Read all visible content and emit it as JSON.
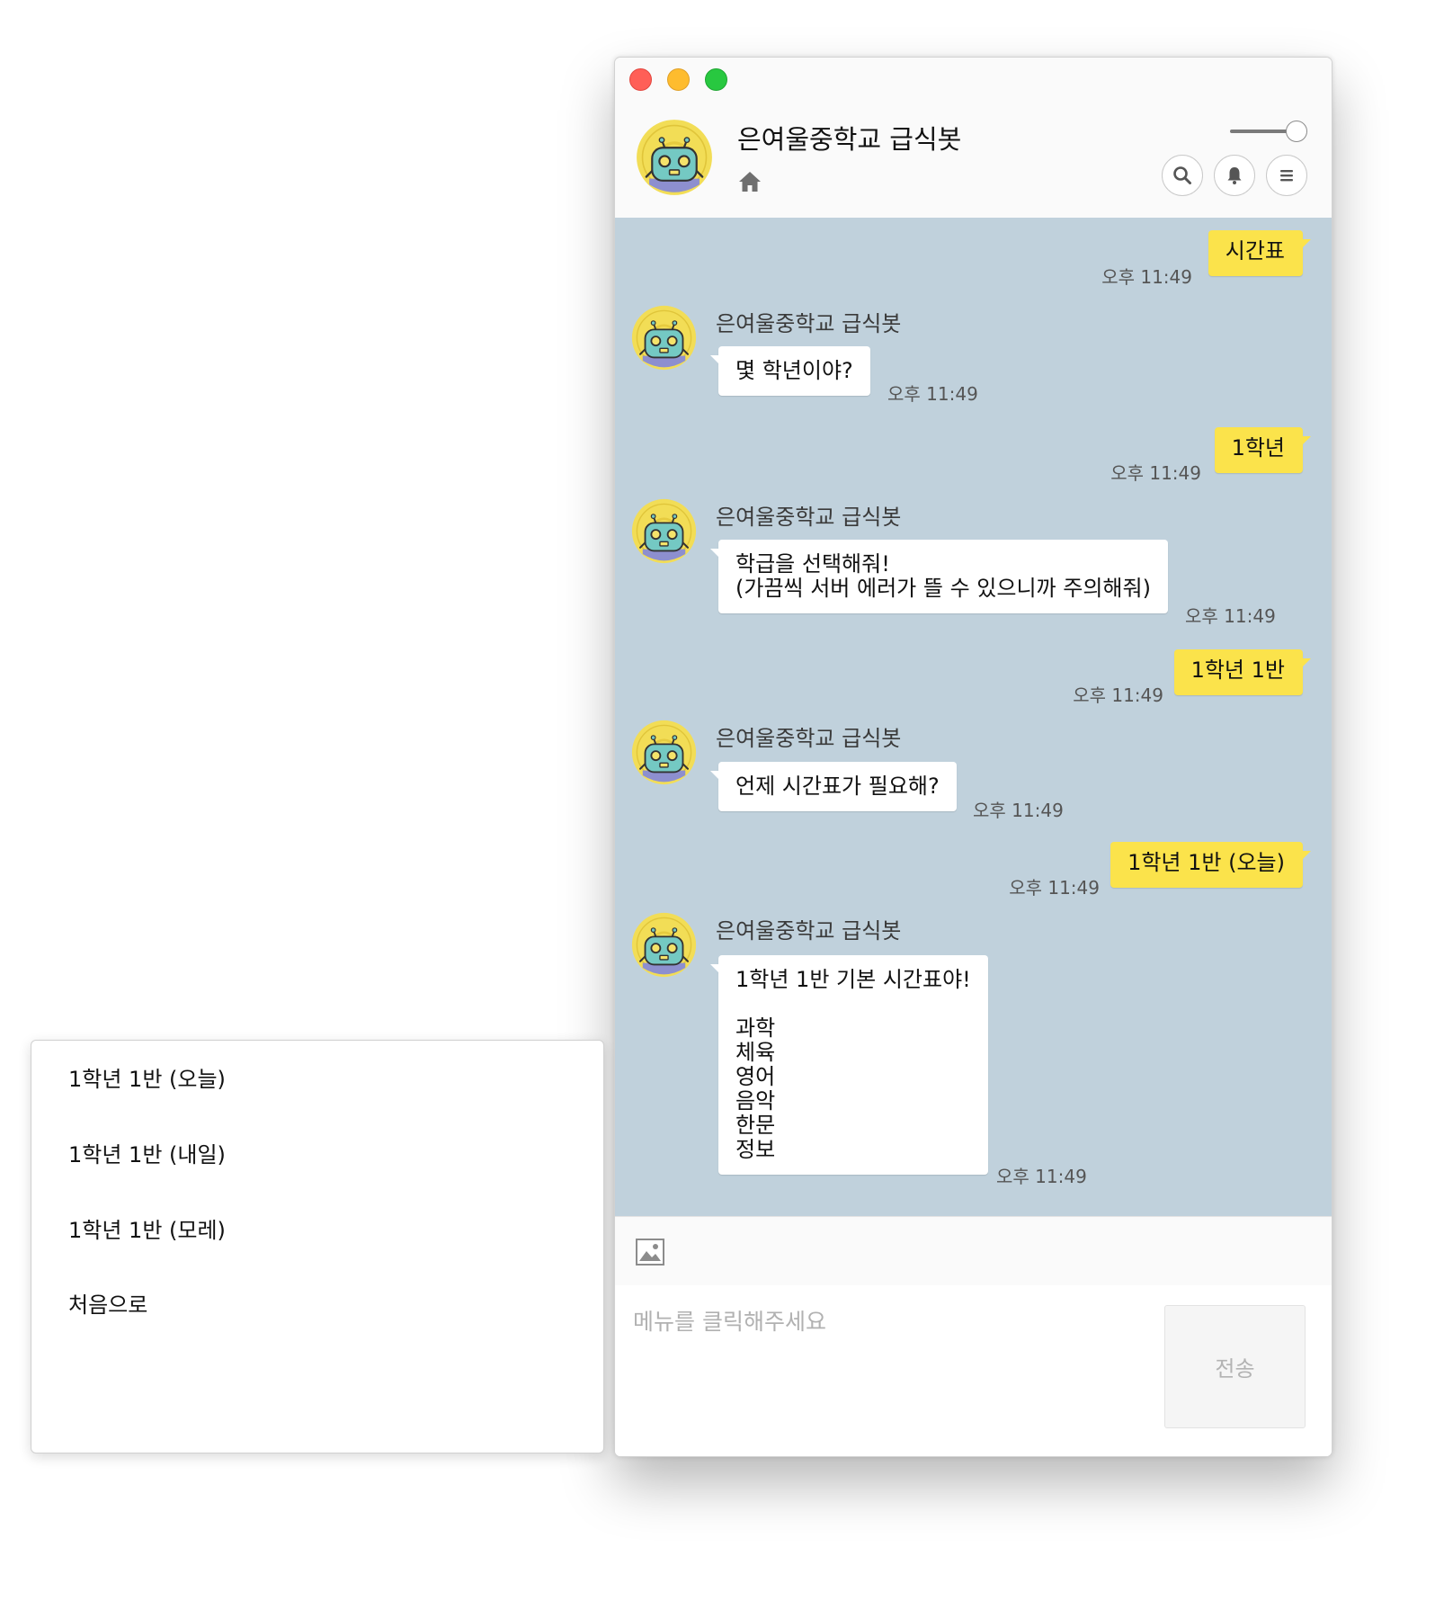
{
  "window": {
    "title": "은여울중학교 급식봇"
  },
  "header": {
    "icons": [
      "home-icon",
      "search-icon",
      "bell-icon",
      "menu-icon"
    ]
  },
  "messages": [
    {
      "dir": "out",
      "text": "시간표",
      "time": "오후 11:49"
    },
    {
      "dir": "in",
      "sender": "은여울중학교 급식봇",
      "text": "몇 학년이야?",
      "time": "오후 11:49"
    },
    {
      "dir": "out",
      "text": "1학년",
      "time": "오후 11:49"
    },
    {
      "dir": "in",
      "sender": "은여울중학교 급식봇",
      "text": "학급을 선택해줘!\n(가끔씩 서버 에러가 뜰 수 있으니까 주의해줘)",
      "time": "오후 11:49"
    },
    {
      "dir": "out",
      "text": "1학년 1반",
      "time": "오후 11:49"
    },
    {
      "dir": "in",
      "sender": "은여울중학교 급식봇",
      "text": "언제 시간표가 필요해?",
      "time": "오후 11:49"
    },
    {
      "dir": "out",
      "text": "1학년 1반 (오늘)",
      "time": "오후 11:49"
    },
    {
      "dir": "in",
      "sender": "은여울중학교 급식봇",
      "text": "1학년 1반 기본 시간표야!\n\n과학\n체육\n영어\n음악\n한문\n정보",
      "time": "오후 11:49"
    }
  ],
  "composer": {
    "placeholder": "메뉴를 클릭해주세요",
    "send_label": "전송"
  },
  "quick_replies": [
    "1학년 1반 (오늘)",
    "1학년 1반 (내일)",
    "1학년 1반 (모레)",
    "처음으로"
  ],
  "colors": {
    "chat_bg": "#c0d1dc",
    "out_bubble": "#fbe34b",
    "in_bubble": "#ffffff",
    "avatar_ring": "#f2dd56",
    "robot_body": "#74c9c3"
  }
}
